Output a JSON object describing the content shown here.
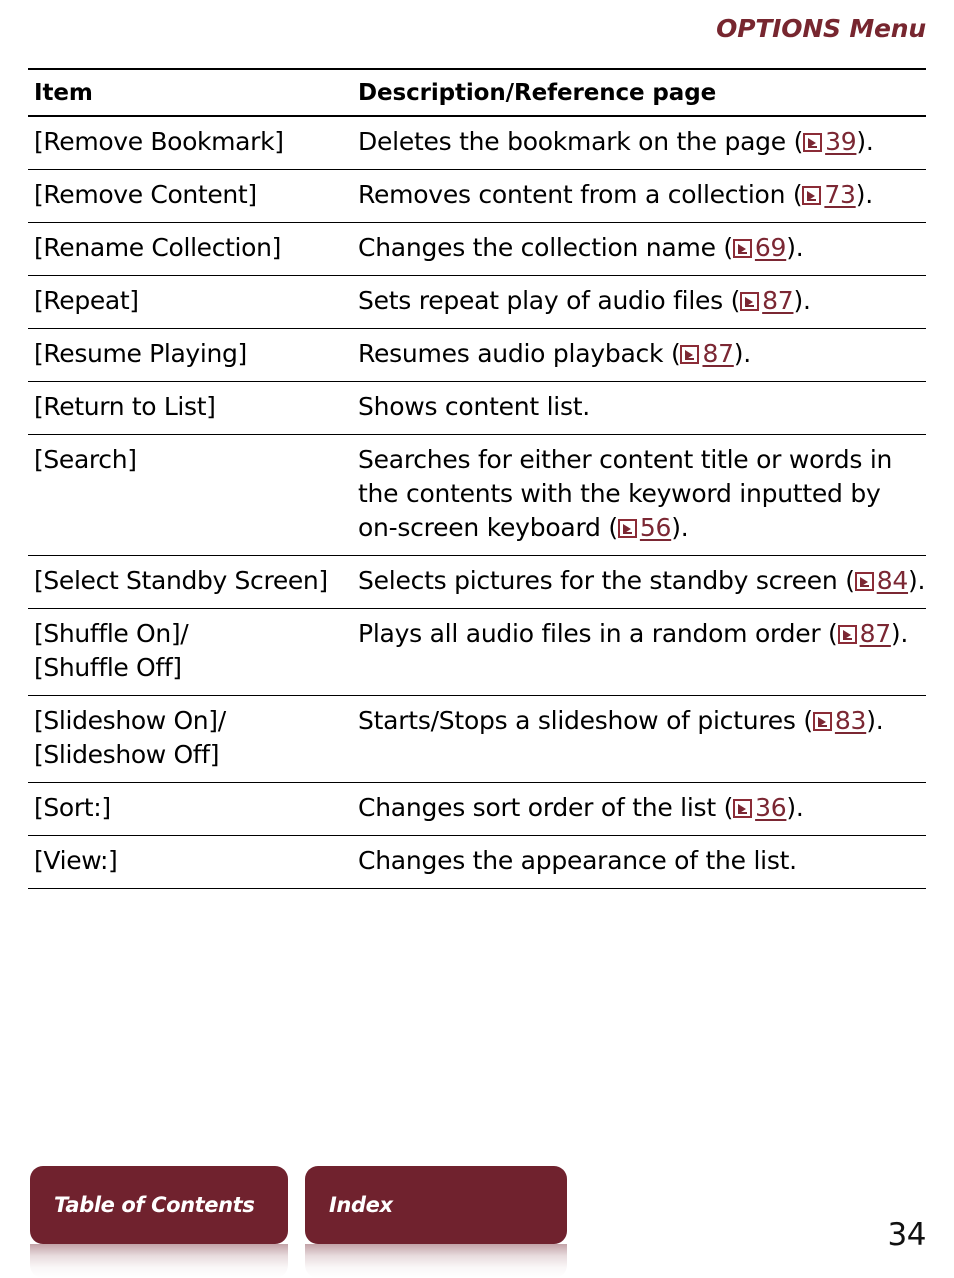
{
  "header": {
    "running_title": "OPTIONS Menu",
    "accent_color": "#77262f"
  },
  "table": {
    "columns": [
      "Item",
      "Description/Reference page"
    ],
    "rows": [
      {
        "item": "[Remove Bookmark]",
        "desc_before": "Deletes the bookmark on the page (",
        "ref_page": "39",
        "desc_after": ")."
      },
      {
        "item": "[Remove Content]",
        "desc_before": "Removes content from a collection (",
        "ref_page": "73",
        "desc_after": ")."
      },
      {
        "item": "[Rename Collection]",
        "desc_before": "Changes the collection name (",
        "ref_page": "69",
        "desc_after": ")."
      },
      {
        "item": "[Repeat]",
        "desc_before": "Sets repeat play of audio files (",
        "ref_page": "87",
        "desc_after": ")."
      },
      {
        "item": "[Resume Playing]",
        "desc_before": "Resumes audio playback (",
        "ref_page": "87",
        "desc_after": ")."
      },
      {
        "item": "[Return to List]",
        "desc_before": "Shows content list.",
        "ref_page": "",
        "desc_after": ""
      },
      {
        "item": "[Search]",
        "desc_before": "Searches for either content title or words in the contents with the keyword inputted by on-screen keyboard (",
        "ref_page": "56",
        "desc_after": ")."
      },
      {
        "item": "[Select Standby Screen]",
        "desc_before": "Selects pictures for the standby screen (",
        "ref_page": "84",
        "desc_after": ")."
      },
      {
        "item": "[Shuffle On]/\n[Shuffle Off]",
        "desc_before": "Plays all audio files in a random order (",
        "ref_page": "87",
        "desc_after": ")."
      },
      {
        "item": "[Slideshow On]/\n[Slideshow Off]",
        "desc_before": "Starts/Stops a slideshow of pictures (",
        "ref_page": "83",
        "desc_after": ")."
      },
      {
        "item": "[Sort:]",
        "desc_before": "Changes sort order of the list (",
        "ref_page": "36",
        "desc_after": ")."
      },
      {
        "item": "[View:]",
        "desc_before": "Changes the appearance of the list.",
        "ref_page": "",
        "desc_after": ""
      }
    ]
  },
  "footer": {
    "buttons": [
      {
        "label": "Table of Contents"
      },
      {
        "label": "Index"
      }
    ],
    "button_color": "#70222e",
    "page_number": "34"
  }
}
